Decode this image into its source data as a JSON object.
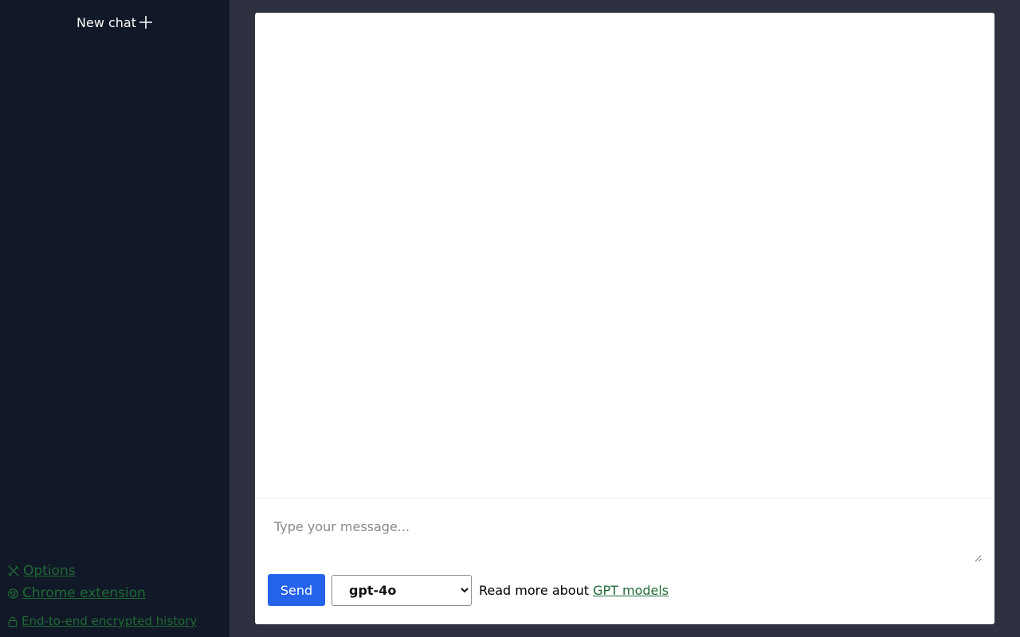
{
  "sidebar": {
    "new_chat_label": "New chat",
    "links": {
      "options": "Options",
      "chrome_extension": "Chrome extension",
      "encrypted_history": "End-to-end encrypted history"
    }
  },
  "composer": {
    "placeholder": "Type your message...",
    "value": ""
  },
  "controls": {
    "send_label": "Send",
    "model_options": [
      "gpt-4o"
    ],
    "selected_model": "gpt-4o",
    "read_more_prefix": "Read more about",
    "read_more_link": "GPT models"
  },
  "colors": {
    "sidebar_bg": "#111827",
    "page_bg": "#2d3140",
    "link_green": "#1f6a35",
    "send_blue": "#2563eb"
  },
  "icons": {
    "new_chat": "plus-icon",
    "options": "tools-icon",
    "chrome_extension": "chrome-icon",
    "encrypted_history": "lock-icon"
  }
}
